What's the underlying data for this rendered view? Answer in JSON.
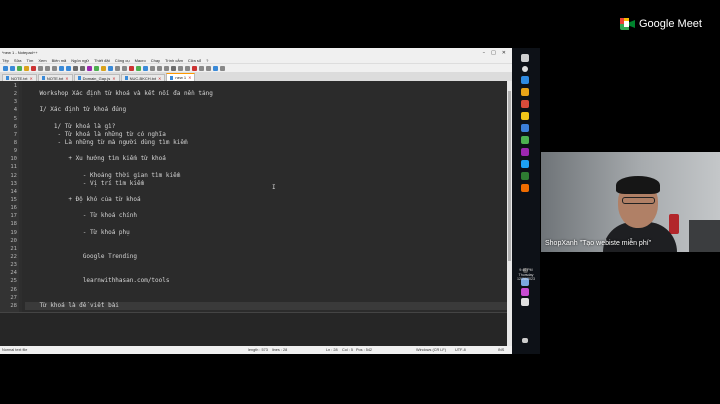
{
  "notepad": {
    "title": "*new 1 - Notepad++",
    "menu": [
      "Tệp",
      "Sửa",
      "Tìm",
      "Xem",
      "Biên mã",
      "Ngôn ngữ",
      "Thiết đặt",
      "Công cụ",
      "Macro",
      "Chạy",
      "Trình cắm",
      "Cửa sổ",
      "?"
    ],
    "tabs": [
      {
        "label": "NOTE.txt"
      },
      {
        "label": "NOTE.txt"
      },
      {
        "label": "Domain_Gap.js"
      },
      {
        "label": "NUC-BKCH.txt"
      },
      {
        "label": "new 1"
      }
    ],
    "lines": [
      "",
      "    Workshop Xác định từ khoá và kết nối đa nền tảng",
      "",
      "    I/ Xác định từ khoá đúng",
      "",
      "        1/ Từ khoá là gì?",
      "         - Từ khoá là những từ có nghĩa",
      "         - Là những từ mà người dùng tìm kiếm",
      "",
      "            + Xu hướng tìm kiếm từ khoá",
      "",
      "                - Khoảng thời gian tìm kiếm",
      "                - Vị trí tìm kiếm",
      "",
      "            + Độ khó của từ khoá",
      "",
      "                - Từ khoá chính",
      "",
      "                - Từ khoá phụ",
      "",
      "",
      "                Google Trending",
      "",
      "",
      "                learnwithhasan.com/tools",
      "",
      "",
      "    Từ khoá là để viết bài"
    ],
    "status": {
      "type": "Normal text file",
      "length": "length : 573",
      "lines": "lines : 28",
      "ln": "Ln : 28",
      "col": "Col : 5",
      "pos": "Pos : 542",
      "eol": "Windows (CR LF)",
      "enc": "UTF-8",
      "ins": "INS"
    }
  },
  "tray": {
    "time": "9:40 PM",
    "day": "Thursday",
    "date": "12/28/2023"
  },
  "meet": {
    "brand": "Google Meet",
    "participant_name": "ShopXanh \"Tạo webiste miễn phí\""
  }
}
